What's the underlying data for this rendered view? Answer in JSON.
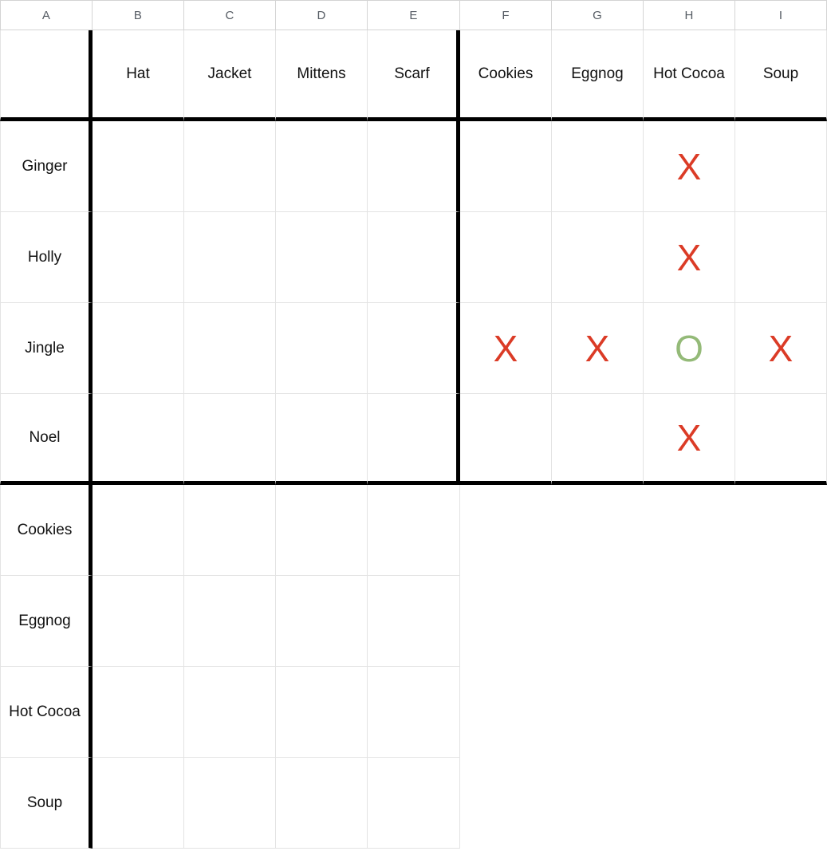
{
  "grid": {
    "column_letters": [
      "A",
      "B",
      "C",
      "D",
      "E",
      "F",
      "G",
      "H",
      "I"
    ],
    "corner_label": "",
    "column_categories": [
      {
        "group": "clothing",
        "labels": [
          "Hat",
          "Jacket",
          "Mittens",
          "Scarf"
        ]
      },
      {
        "group": "treats",
        "labels": [
          "Cookies",
          "Eggnog",
          "Hot Cocoa",
          "Soup"
        ]
      }
    ],
    "row_categories": [
      {
        "group": "names",
        "labels": [
          "Ginger",
          "Holly",
          "Jingle",
          "Noel"
        ]
      },
      {
        "group": "treats",
        "labels": [
          "Cookies",
          "Eggnog",
          "Hot Cocoa",
          "Soup"
        ]
      }
    ],
    "marks": {
      "x": "X",
      "o": "O"
    },
    "colors": {
      "x": "#DB3B26",
      "o": "#94BA78",
      "gridline": "#e3e3e3",
      "heavy_border": "#000000",
      "header_text": "#555b63",
      "label_text": "#111111"
    },
    "blocks": {
      "names_by_clothing": [
        [
          "",
          "",
          "",
          ""
        ],
        [
          "",
          "",
          "",
          ""
        ],
        [
          "",
          "",
          "",
          ""
        ],
        [
          "",
          "",
          "",
          ""
        ]
      ],
      "names_by_treats": [
        [
          "",
          "",
          "X",
          ""
        ],
        [
          "",
          "",
          "X",
          ""
        ],
        [
          "X",
          "X",
          "O",
          "X"
        ],
        [
          "",
          "",
          "X",
          ""
        ]
      ],
      "treats_by_clothing": [
        [
          "",
          "",
          "",
          ""
        ],
        [
          "",
          "",
          "",
          ""
        ],
        [
          "",
          "",
          "",
          ""
        ],
        [
          "",
          "",
          "",
          ""
        ]
      ]
    }
  }
}
